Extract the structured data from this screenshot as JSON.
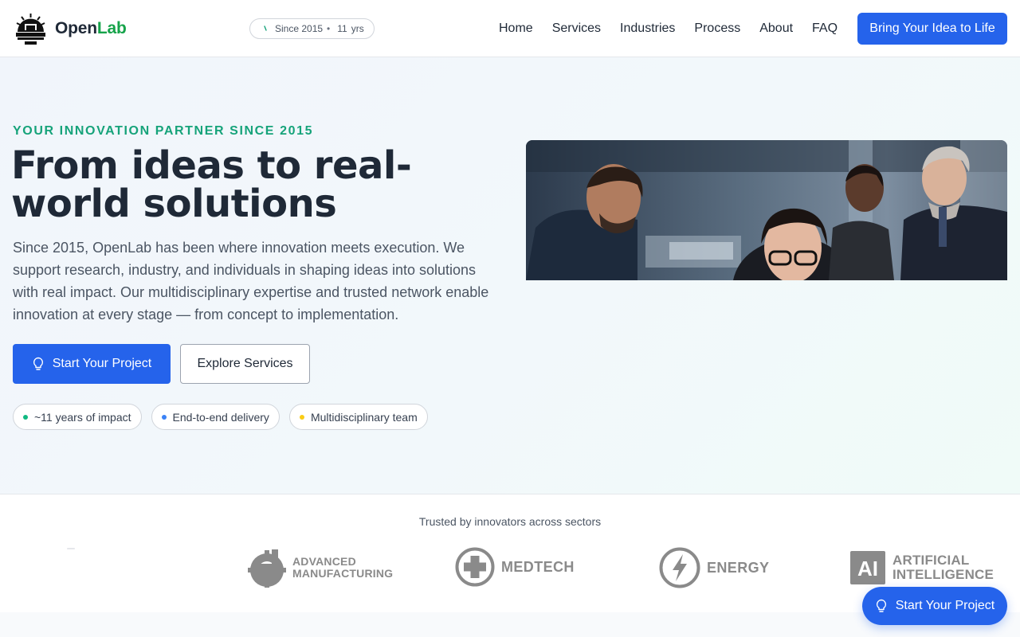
{
  "header": {
    "logo_text_primary": "Open",
    "logo_text_accent": "Lab",
    "since_pill": {
      "label": "Since 2015",
      "separator": "•",
      "years_value": "11",
      "years_unit": "yrs"
    },
    "nav": [
      "Home",
      "Services",
      "Industries",
      "Process",
      "About",
      "FAQ"
    ],
    "cta_label": "Bring Your Idea to Life"
  },
  "hero": {
    "eyebrow": "YOUR INNOVATION PARTNER SINCE 2015",
    "headline": "From ideas to real-world solutions",
    "lead": "Since 2015, OpenLab has been where innovation meets execution. We support research, industry, and individuals in shaping ideas into solutions with real impact. Our multidisciplinary expertise and trusted network enable innovation at every stage — from concept to implementation.",
    "primary_button": "Start Your Project",
    "secondary_button": "Explore Services",
    "chips": [
      {
        "label": "~11 years of impact",
        "dot_color": "#10b981"
      },
      {
        "label": "End-to-end delivery",
        "dot_color": "#3b82f6"
      },
      {
        "label": "Multidisciplinary team",
        "dot_color": "#facc15"
      }
    ]
  },
  "trusted": {
    "title": "Trusted by innovators across sectors",
    "sectors": [
      {
        "line1": "ADVANCED",
        "line2": "MANUFACTURING",
        "icon": "factory-icon"
      },
      {
        "line1": "MEDTECH",
        "icon": "medical-cross-icon"
      },
      {
        "line1": "ENERGY",
        "icon": "lightning-icon"
      },
      {
        "line1": "ARTIFICIAL",
        "line2": "INTELLIGENCE",
        "icon": "ai-icon",
        "badge": "AI"
      }
    ]
  },
  "floating_cta": {
    "label": "Start Your Project"
  },
  "colors": {
    "primary": "#2563eb",
    "accent_green": "#16a37a",
    "text_dark": "#1f2937",
    "sector_gray": "#8a8a8a"
  }
}
